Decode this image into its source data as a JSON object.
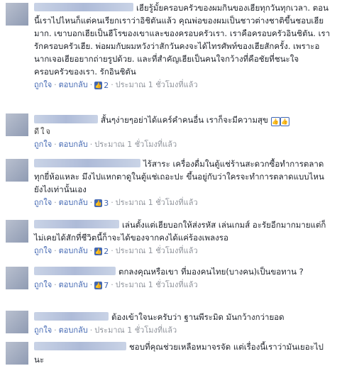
{
  "actions": {
    "like": "ถูกใจ",
    "reply": "ตอบกลับ",
    "time": "ประมาณ 1 ชั่วโมงที่แล้ว"
  },
  "comments": [
    {
      "text": "เฮียรู้มั้ยครอบครัวของผมกินของเฮียทุกวันทุกเวลา. ตอนนี้เราไปไหนก็แต่คนเรียกเราว่าอิชิตันแล้ว คุณพ่อของผมเป็นชาวต่างชาติขึ้นชอบเฮียมาก. เขาบอกเฮียเป็นฮีโรของเขาและของครอบครัวเรา. เราคือครอบครัวอินชิตัน. เรารักครอบครัวเฮีย. พ่อผมกับผมหวังว่าสักวันคงจะได้ไทรศัพท์ของเฮียสักครั้ง. เพราะอนากเจอเฮียอยากถ่ายรูปด้วย. และที่สำคัญเฮียเป็นคนใจกว้างที่คือชัยที่ชนะใจครอบครัวของเรา. รักอินชิตัน",
      "likes": "2"
    },
    {
      "text": "สั้นๆง่ายๆอย่าได้แคร์คำคนอื่น เราก็จะมีความสุข",
      "symbols": "ดีใจ",
      "likes": ""
    },
    {
      "text": "ไร้สาระ เครื่องดื่มในตู้แช่ร้านสะดวกซื้อทำการตลาดทุกยี่ห้อแหละ มึงไปแหกตาดูในตู้แช่เถอะปะ ขึ้นอยู่กับว่าใครจะทำการตลาดแบบไหนยังไงเท่านั้นเอง",
      "likes": "3"
    },
    {
      "text": "เล่นตั้งแต่เฮียบอกให้ส่งรหัส เล่นเกมส์ อะรัยอีกมากมายแต่ก็ไม่เคยได้สักที่ชีวิตนี้ก็าจะได้ของจากคงได้แค่ร้องเพลงรอ",
      "likes": "2"
    },
    {
      "text": "ตกลงคุณหรือเขา ที่มองคนไทย(บางคน)เป็นขอทาน ?",
      "likes": "7"
    },
    {
      "text": "ต้องเข้าใจนะครับว่า ฐานพีระมิด มันกว้างกว่ายอด",
      "likes": ""
    },
    {
      "text": "ชอบที่คุณช่วยเหลือหมาจรจัด แต่เรื่องนี้เราว่ามันเยอะไปนะ",
      "likes": ""
    }
  ]
}
